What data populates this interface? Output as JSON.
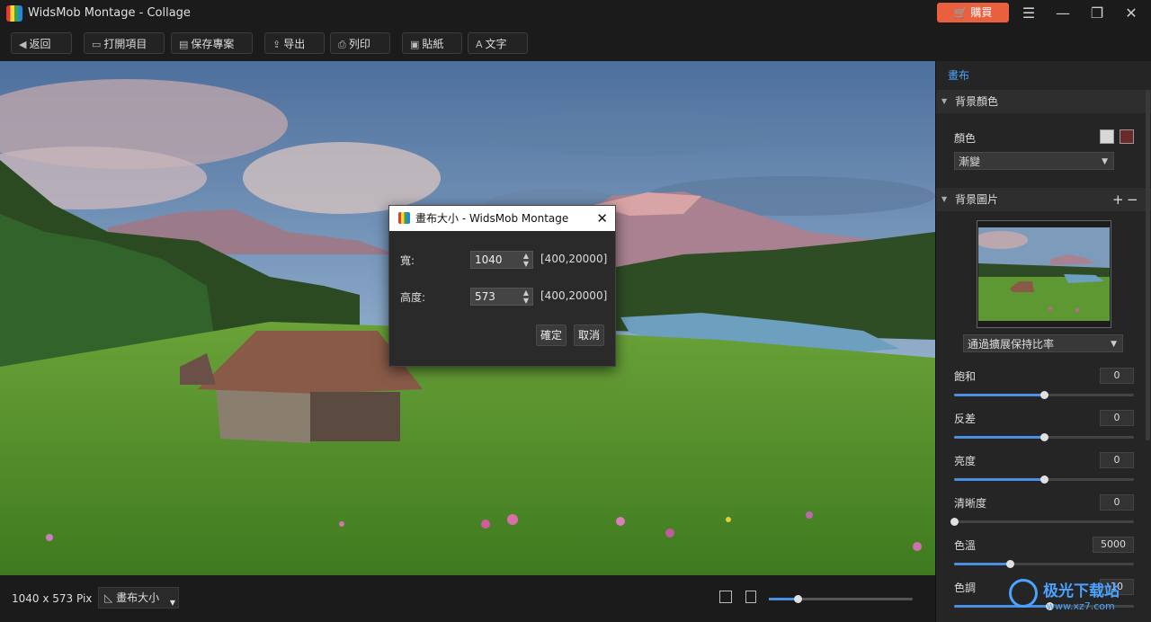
{
  "window": {
    "title": "WidsMob Montage - Collage",
    "buy_label": "購買",
    "menu_icon": "menu-icon",
    "minimize_icon": "minimize-icon",
    "maximize_icon": "maximize-icon",
    "close_icon": "close-icon"
  },
  "toolbar": {
    "back": "返回",
    "open_project": "打開項目",
    "save_project": "保存專案",
    "export": "导出",
    "print": "列印",
    "sticker": "貼紙",
    "text": "文字"
  },
  "dialog": {
    "title": "畫布大小 - WidsMob Montage",
    "width_label": "寬:",
    "width_value": "1040",
    "width_range": "[400,20000]",
    "height_label": "高度:",
    "height_value": "573",
    "height_range": "[400,20000]",
    "ok": "確定",
    "cancel": "取消"
  },
  "bottom": {
    "dimensions": "1040 x 573 Pix",
    "canvas_size": "畫布大小",
    "zoom_level": 0.2
  },
  "panel": {
    "title": "畫布",
    "bg_color_section": "背景顏色",
    "color_label": "顏色",
    "fill_mode": "漸變",
    "swatch1": "#d8d8d8",
    "swatch2": "#6b2a28",
    "bg_image_section": "背景圖片",
    "fit_mode": "通過擴展保持比率",
    "adjustments": [
      {
        "label": "飽和",
        "value": "0",
        "level": 0.5
      },
      {
        "label": "反差",
        "value": "0",
        "level": 0.5
      },
      {
        "label": "亮度",
        "value": "0",
        "level": 0.5
      },
      {
        "label": "清晰度",
        "value": "0",
        "level": 0.0
      },
      {
        "label": "色溫",
        "value": "5000",
        "level": 0.31
      },
      {
        "label": "色調",
        "value": "10",
        "level": 0.53
      }
    ]
  },
  "watermark": {
    "text": "极光下载站",
    "url": "www.xz7.com"
  }
}
